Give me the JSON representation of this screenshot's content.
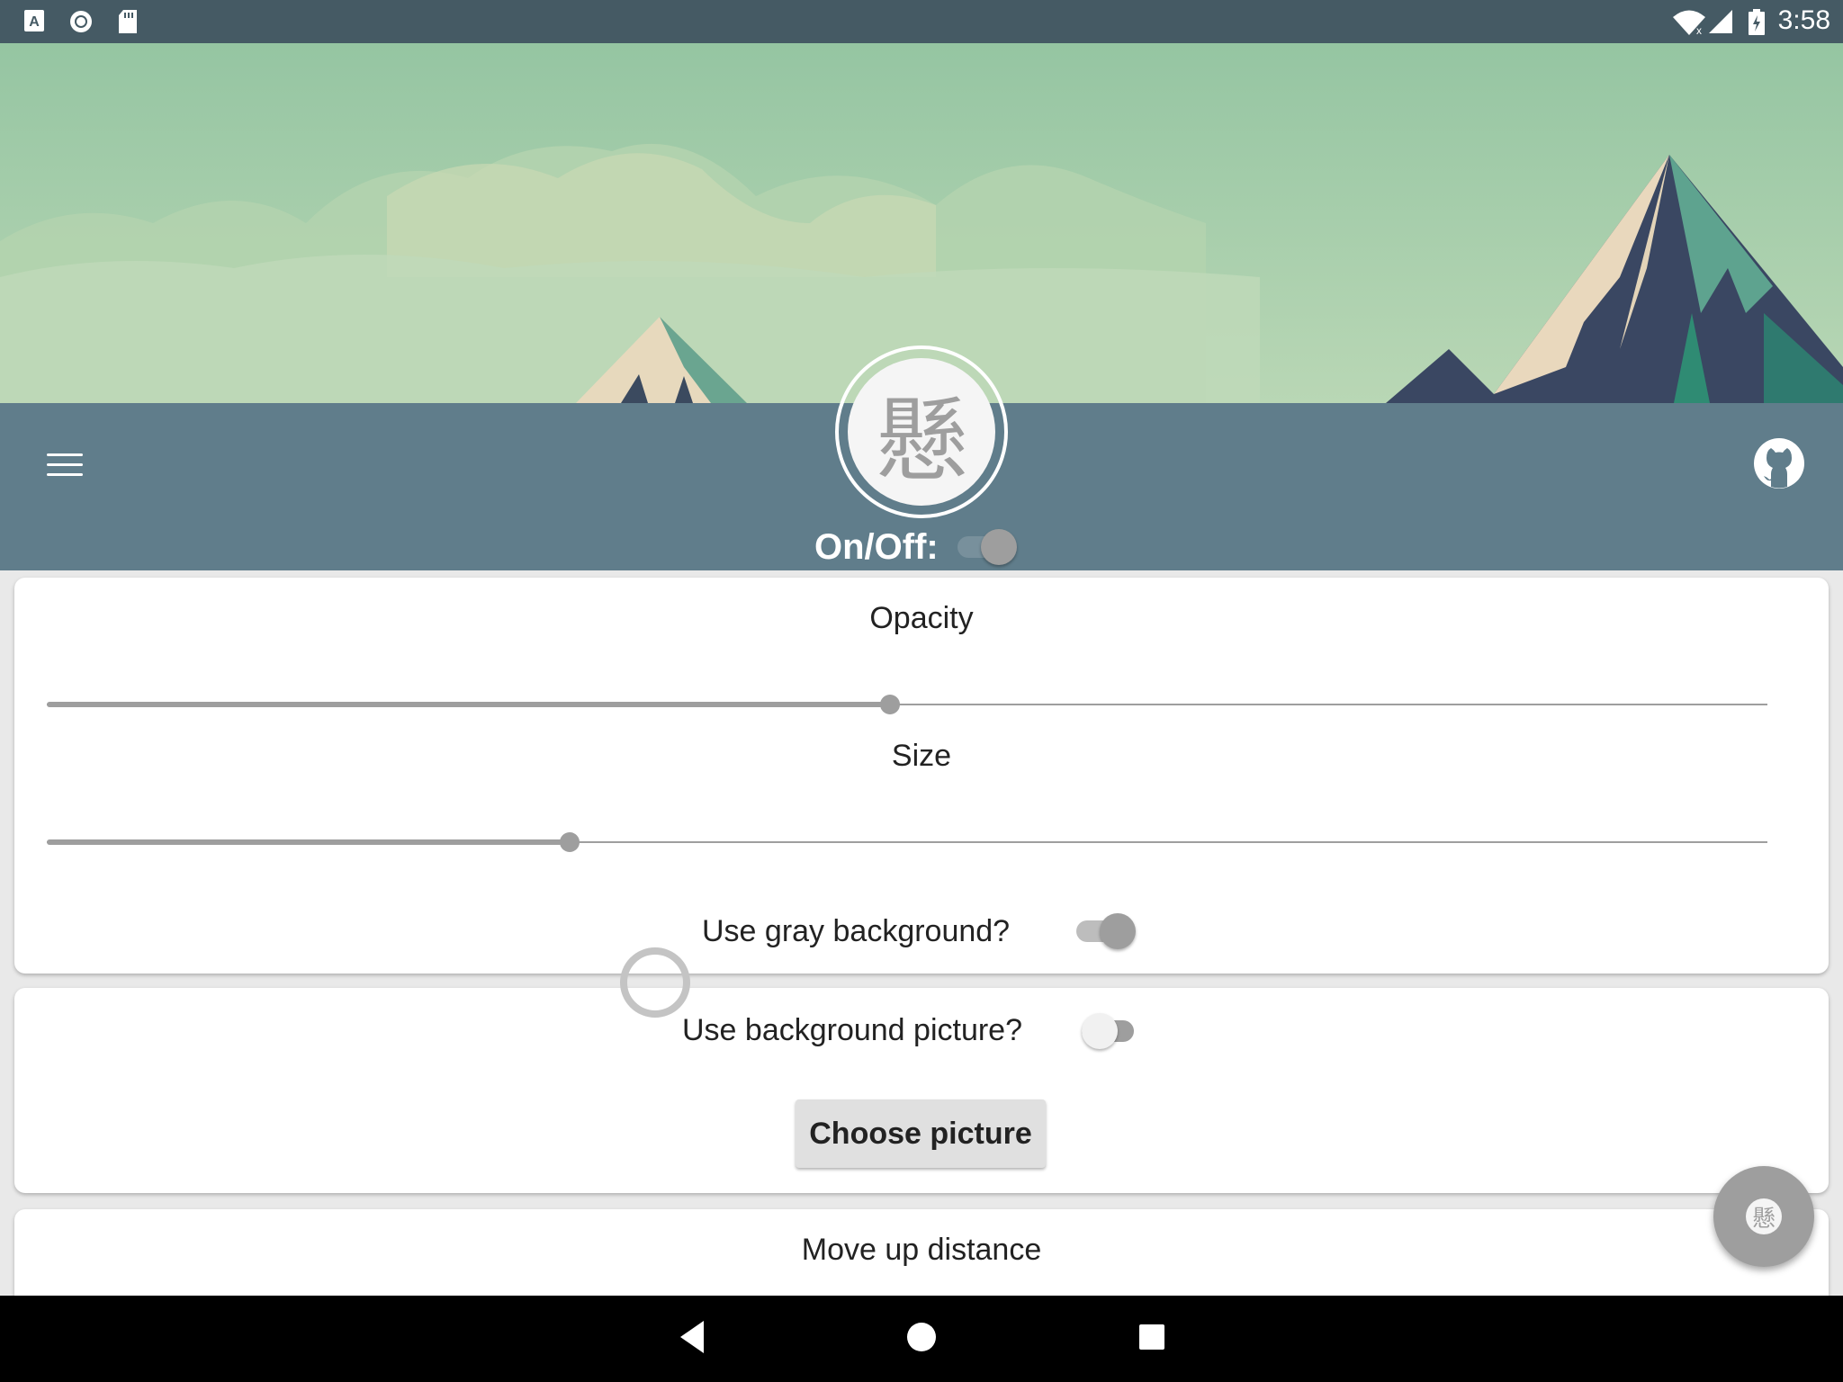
{
  "status_bar": {
    "time": "3:58",
    "left_icons": [
      "text-a-icon",
      "circle-record-icon",
      "sd-card-icon"
    ],
    "right_icons": [
      "wifi-icon",
      "signal-icon",
      "battery-icon"
    ]
  },
  "header": {
    "logo_char": "懸",
    "onoff_label": "On/Off:",
    "onoff_state": "on"
  },
  "card_opacity_size": {
    "opacity_title": "Opacity",
    "opacity_value_fraction": 0.49,
    "size_title": "Size",
    "size_value_fraction": 0.304,
    "gray_bg_label": "Use gray background?",
    "gray_bg_state": "on"
  },
  "card_background": {
    "bg_picture_label": "Use background picture?",
    "bg_picture_state": "off",
    "choose_button": "Choose picture"
  },
  "card_move": {
    "title": "Move up distance"
  },
  "fab": {
    "char": "懸"
  },
  "colors": {
    "status_bar": "#455a64",
    "app_bar": "#607d8b",
    "accent_gray": "#9e9e9e"
  }
}
